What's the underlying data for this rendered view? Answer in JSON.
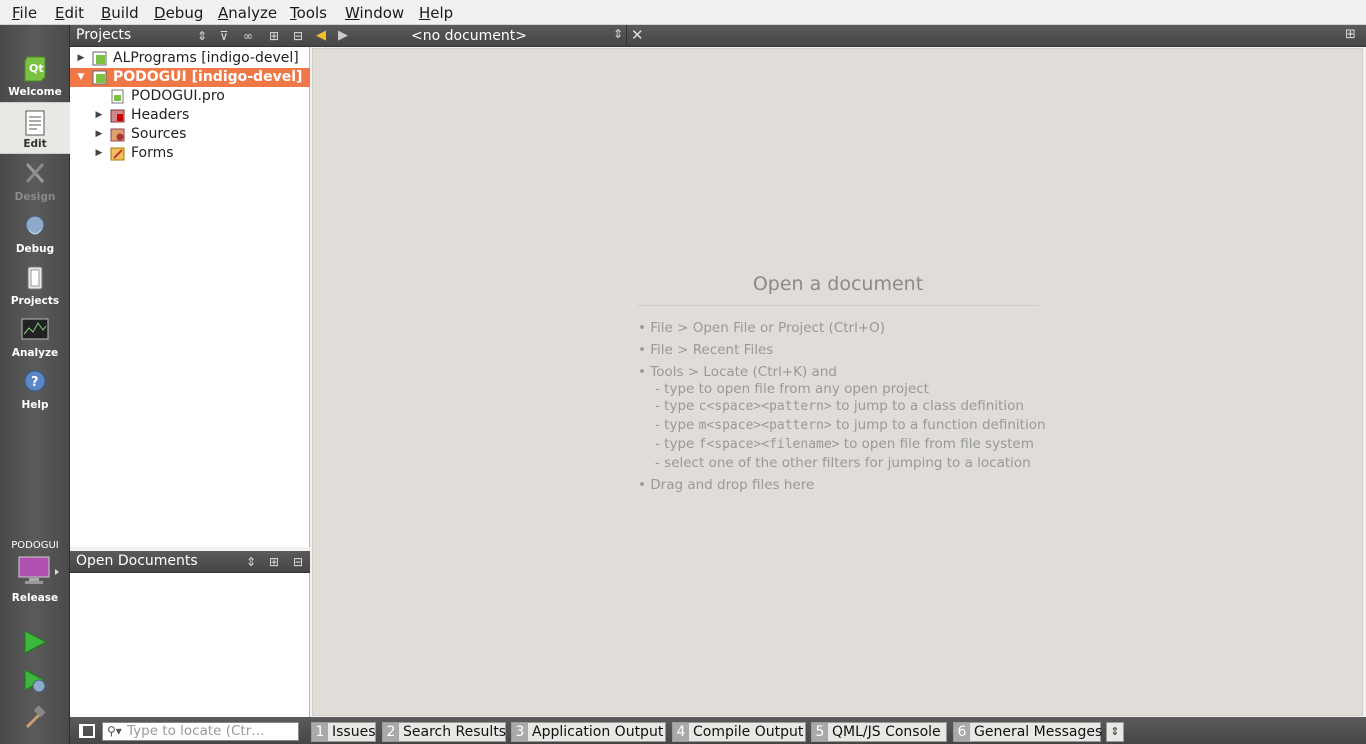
{
  "menu": [
    {
      "label": "File",
      "mnemonic": "F",
      "rest": "ile"
    },
    {
      "label": "Edit",
      "mnemonic": "E",
      "rest": "dit"
    },
    {
      "label": "Build",
      "mnemonic": "B",
      "rest": "uild"
    },
    {
      "label": "Debug",
      "mnemonic": "D",
      "rest": "ebug"
    },
    {
      "label": "Analyze",
      "mnemonic": "A",
      "rest": "nalyze"
    },
    {
      "label": "Tools",
      "mnemonic": "T",
      "rest": "ools"
    },
    {
      "label": "Window",
      "mnemonic": "W",
      "rest": "indow"
    },
    {
      "label": "Help",
      "mnemonic": "H",
      "rest": "elp"
    }
  ],
  "modes": {
    "welcome": "Welcome",
    "edit": "Edit",
    "design": "Design",
    "debug": "Debug",
    "projects": "Projects",
    "analyze": "Analyze",
    "help": "Help"
  },
  "kit": {
    "project": "PODOGUI",
    "config": "Release"
  },
  "projects_panel": {
    "title": "Projects",
    "tree": {
      "alprograms": "ALPrograms [indigo-devel]",
      "podogui": "PODOGUI [indigo-devel]",
      "pro_file": "PODOGUI.pro",
      "headers": "Headers",
      "sources": "Sources",
      "forms": "Forms"
    }
  },
  "open_documents_panel": {
    "title": "Open Documents"
  },
  "editor": {
    "document_selector": "<no document>",
    "placeholder_title": "Open a document",
    "hints": {
      "h1": "• File > Open File or Project (Ctrl+O)",
      "h2": "• File > Recent Files",
      "h3": "• Tools > Locate (Ctrl+K) and",
      "h3a": "- type to open file from any open project",
      "h3b_pre": "- type ",
      "h3b_code": "c<space><pattern>",
      "h3b_post": " to jump to a class definition",
      "h3c_pre": "- type ",
      "h3c_code": "m<space><pattern>",
      "h3c_post": " to jump to a function definition",
      "h3d_pre": "- type ",
      "h3d_code": "f<space><filename>",
      "h3d_post": " to open file from file system",
      "h3e": "- select one of the other filters for jumping to a location",
      "h4": "• Drag and drop files here"
    }
  },
  "bottom": {
    "locate_placeholder": "Type to locate (Ctr…",
    "tabs": [
      {
        "num": "1",
        "label": "Issues"
      },
      {
        "num": "2",
        "label": "Search Results"
      },
      {
        "num": "3",
        "label": "Application Output"
      },
      {
        "num": "4",
        "label": "Compile Output"
      },
      {
        "num": "5",
        "label": "QML/JS Console"
      },
      {
        "num": "6",
        "label": "General Messages"
      }
    ]
  },
  "colors": {
    "selection": "#f07746",
    "panel_header": "#505050",
    "editor_bg": "#e0ddd8"
  }
}
